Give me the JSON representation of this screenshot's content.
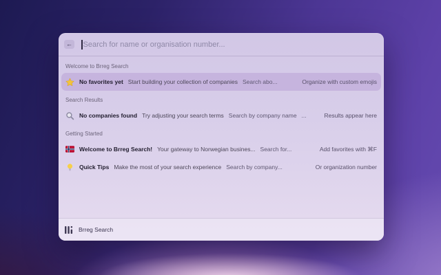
{
  "colors": {
    "selected_row": "#c6b4de",
    "star_gold": "#f2c33e",
    "star_gold_dark": "#d9a521",
    "magnifier_gray": "#8d8aa2",
    "magnifier_lens": "#e8e6f0",
    "flag_red": "#ba0c2f",
    "flag_blue": "#00205b",
    "flag_white": "#ffffff",
    "bulb_yellow": "#f7d04b",
    "bulb_base": "#b6b0c4",
    "logo_dark": "#3e3852"
  },
  "window": {
    "search": {
      "back_label": "←",
      "placeholder": "Search for name or organisation number...",
      "value": ""
    },
    "sections": [
      {
        "label": "Welcome to Brreg Search",
        "items": [
          {
            "icon": "star",
            "title": "No favorites yet",
            "subtitle": "Start building your collection of companies",
            "accessories": [
              "Search abo..."
            ],
            "right": "Organize with custom emojis",
            "selected": true
          }
        ]
      },
      {
        "label": "Search Results",
        "items": [
          {
            "icon": "magnifier",
            "title": "No companies found",
            "subtitle": "Try adjusting your search terms",
            "accessories": [
              "Search by company name",
              "..."
            ],
            "right": "Results appear here",
            "selected": false
          }
        ]
      },
      {
        "label": "Getting Started",
        "items": [
          {
            "icon": "norway-flag",
            "title": "Welcome to Brreg Search!",
            "subtitle": "Your gateway to Norwegian busines...",
            "accessories": [
              "Search for..."
            ],
            "right": "Add favorites with ⌘F",
            "selected": false
          },
          {
            "icon": "bulb",
            "title": "Quick Tips",
            "subtitle": "Make the most of your search experience",
            "accessories": [
              "Search by company..."
            ],
            "right": "Or organization number",
            "selected": false
          }
        ]
      }
    ],
    "footer": {
      "app_name": "Brreg Search"
    }
  }
}
